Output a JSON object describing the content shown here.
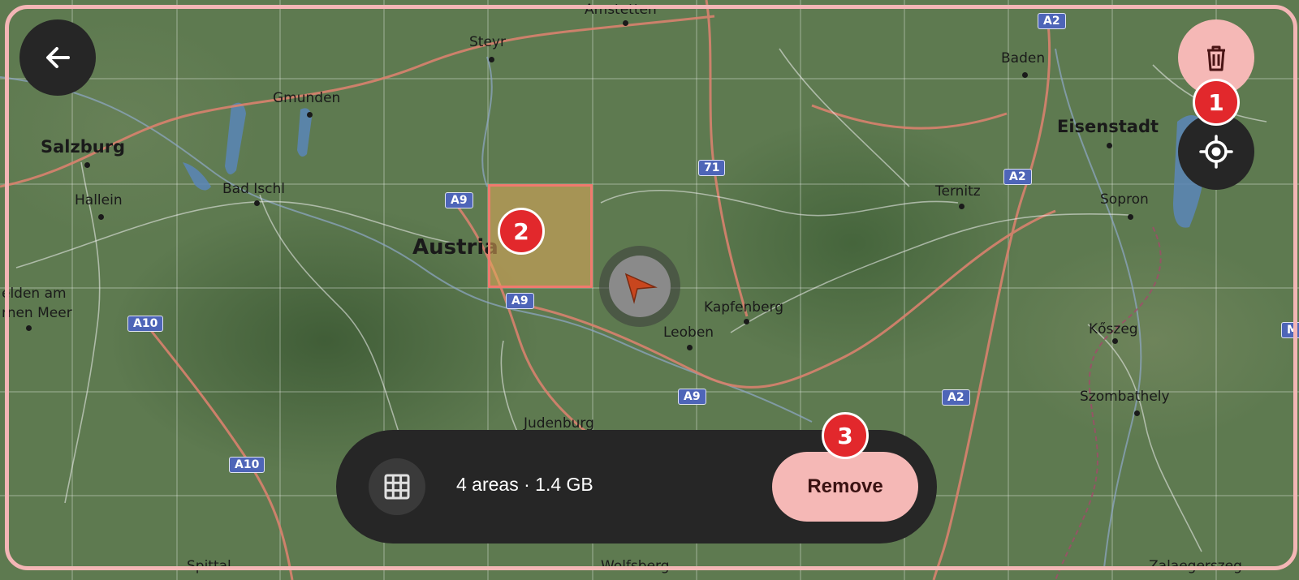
{
  "map": {
    "places": [
      {
        "name": "Amstetten",
        "size": "small"
      },
      {
        "name": "Steyr",
        "size": "small"
      },
      {
        "name": "Baden",
        "size": "small"
      },
      {
        "name": "Gmunden",
        "size": "small"
      },
      {
        "name": "Eisenstadt",
        "size": "med"
      },
      {
        "name": "Salzburg",
        "size": "med"
      },
      {
        "name": "Hallein",
        "size": "small"
      },
      {
        "name": "Bad Ischl",
        "size": "small"
      },
      {
        "name": "Ternitz",
        "size": "small"
      },
      {
        "name": "Sopron",
        "size": "small"
      },
      {
        "name": "Austria",
        "size": "big"
      },
      {
        "name": "elden am",
        "size": "small"
      },
      {
        "name": "rnen Meer",
        "size": "small"
      },
      {
        "name": "Kapfenberg",
        "size": "small"
      },
      {
        "name": "Leoben",
        "size": "small"
      },
      {
        "name": "Kőszeg",
        "size": "small"
      },
      {
        "name": "Szombathely",
        "size": "small"
      },
      {
        "name": "Judenburg",
        "size": "small"
      },
      {
        "name": "Spittal",
        "size": "small"
      },
      {
        "name": "Wolfsberg",
        "size": "small"
      },
      {
        "name": "Zalaegerszeg",
        "size": "small"
      }
    ],
    "road_shields": [
      "A2",
      "A2",
      "A9",
      "71",
      "A9",
      "A10",
      "A9",
      "A2",
      "A10",
      "M"
    ]
  },
  "toolbar": {
    "back_icon": "arrow-left-icon",
    "delete_icon": "trash-icon",
    "locate_icon": "crosshair-icon"
  },
  "badges": [
    "1",
    "2",
    "3"
  ],
  "bottom_bar": {
    "grid_icon": "grid-icon",
    "summary": "4 areas · 1.4 GB",
    "remove_label": "Remove"
  },
  "colors": {
    "accent": "#f5b8b6",
    "badge": "#e2282c",
    "dark": "#262626",
    "selection_border": "#f07a6e",
    "shield": "#4e65b8"
  }
}
